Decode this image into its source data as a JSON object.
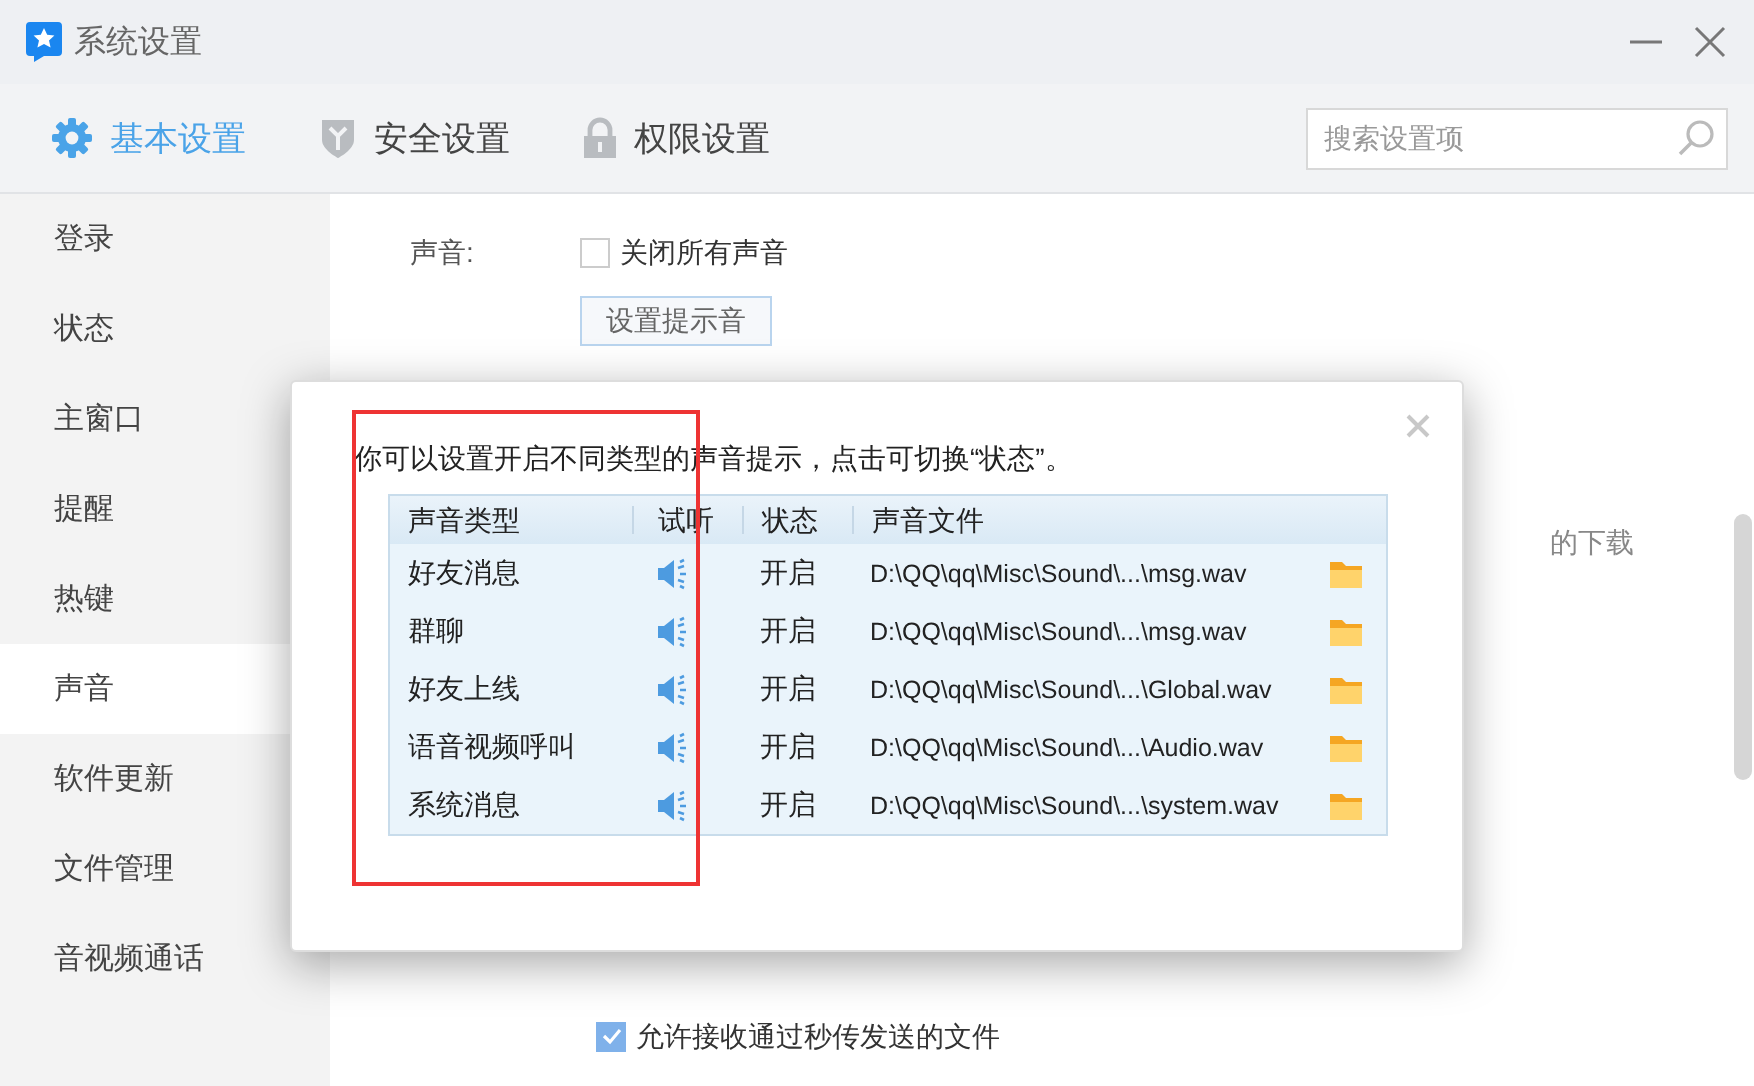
{
  "window": {
    "title": "系统设置"
  },
  "tabs": [
    {
      "label": "基本设置",
      "selected": true
    },
    {
      "label": "安全设置",
      "selected": false
    },
    {
      "label": "权限设置",
      "selected": false
    }
  ],
  "search": {
    "placeholder": "搜索设置项"
  },
  "sidebar": {
    "items": [
      {
        "label": "登录",
        "selected": false
      },
      {
        "label": "状态",
        "selected": false
      },
      {
        "label": "主窗口",
        "selected": false
      },
      {
        "label": "提醒",
        "selected": false
      },
      {
        "label": "热键",
        "selected": false
      },
      {
        "label": "声音",
        "selected": true
      },
      {
        "label": "软件更新",
        "selected": false
      },
      {
        "label": "文件管理",
        "selected": false
      },
      {
        "label": "音视频通话",
        "selected": false
      }
    ]
  },
  "sound_section": {
    "label": "声音:",
    "mute_all": {
      "label": "关闭所有声音",
      "checked": false
    },
    "button": "设置提示音"
  },
  "partial_text": "的下载",
  "receive_option": {
    "label": "允许接收通过秒传发送的文件",
    "checked": true
  },
  "dialog": {
    "intro": "你可以设置开启不同类型的声音提示，点击可切换“状态”。",
    "table": {
      "columns": [
        "声音类型",
        "试听",
        "状态",
        "声音文件"
      ],
      "rows": [
        {
          "type": "好友消息",
          "status": "开启",
          "file": "D:\\QQ\\qq\\Misc\\Sound\\...\\msg.wav"
        },
        {
          "type": "群聊",
          "status": "开启",
          "file": "D:\\QQ\\qq\\Misc\\Sound\\...\\msg.wav"
        },
        {
          "type": "好友上线",
          "status": "开启",
          "file": "D:\\QQ\\qq\\Misc\\Sound\\...\\Global.wav"
        },
        {
          "type": "语音视频呼叫",
          "status": "开启",
          "file": "D:\\QQ\\qq\\Misc\\Sound\\...\\Audio.wav"
        },
        {
          "type": "系统消息",
          "status": "开启",
          "file": "D:\\QQ\\qq\\Misc\\Sound\\...\\system.wav"
        }
      ]
    }
  }
}
